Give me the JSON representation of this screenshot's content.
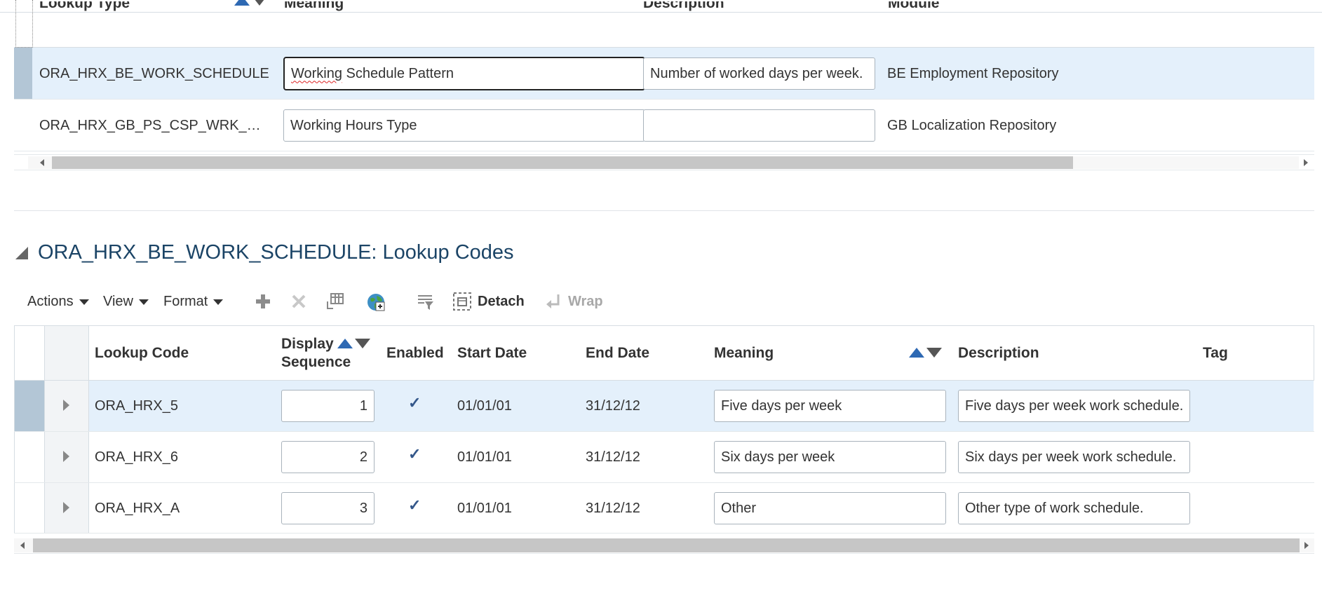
{
  "lookup_types": {
    "columns": {
      "lookup_type": "Lookup Type",
      "meaning": "Meaning",
      "description": "Description",
      "module": "Module"
    },
    "rows": [
      {
        "lookup_type": "ORA_HRX_BE_WORK_SCHEDULE",
        "meaning_word1": "Working",
        "meaning_rest": " Schedule Pattern",
        "description": "Number of worked days per week.",
        "module": "BE Employment Repository"
      },
      {
        "lookup_type": "ORA_HRX_GB_PS_CSP_WRK_H…",
        "meaning": "Working Hours Type",
        "description": "",
        "module": "GB Localization Repository"
      }
    ]
  },
  "section": {
    "title": "ORA_HRX_BE_WORK_SCHEDULE: Lookup Codes"
  },
  "toolbar": {
    "actions": "Actions",
    "view": "View",
    "format": "Format",
    "detach": "Detach",
    "wrap": "Wrap"
  },
  "lookup_codes": {
    "columns": {
      "lookup_code": "Lookup Code",
      "display": "Display",
      "sequence": "Sequence",
      "enabled": "Enabled",
      "start_date": "Start Date",
      "end_date": "End Date",
      "meaning": "Meaning",
      "description": "Description",
      "tag": "Tag"
    },
    "rows": [
      {
        "code": "ORA_HRX_5",
        "seq": "1",
        "enabled": "✓",
        "start": "01/01/01",
        "end": "31/12/12",
        "meaning": "Five days per week",
        "description": "Five days per week work schedule."
      },
      {
        "code": "ORA_HRX_6",
        "seq": "2",
        "enabled": "✓",
        "start": "01/01/01",
        "end": "31/12/12",
        "meaning": "Six days per week",
        "description": "Six days per week work schedule."
      },
      {
        "code": "ORA_HRX_A",
        "seq": "3",
        "enabled": "✓",
        "start": "01/01/01",
        "end": "31/12/12",
        "meaning": "Other",
        "description": "Other type of work schedule."
      }
    ]
  },
  "colors": {
    "selected_row": "#e4f0fb",
    "row_selector": "#b3c6d6",
    "section_title": "#1b4466",
    "sort_active": "#2e69b3"
  }
}
